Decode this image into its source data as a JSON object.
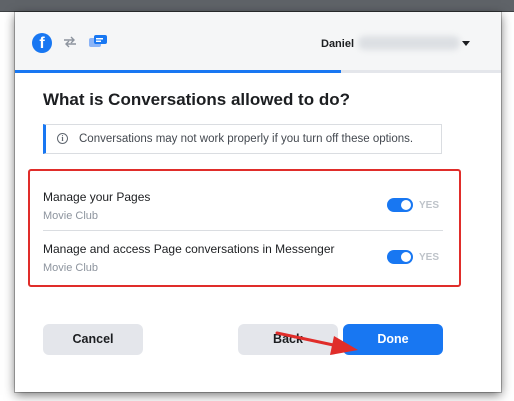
{
  "header": {
    "logo": "facebook-logo",
    "user_name": "Daniel"
  },
  "progress": {
    "fraction": 0.67
  },
  "dialog": {
    "title": "What is Conversations allowed to do?",
    "notice": "Conversations may not work properly if you turn off these options."
  },
  "permissions": [
    {
      "title": "Manage your Pages",
      "subtitle": "Movie Club",
      "toggle_label": "YES",
      "enabled": true
    },
    {
      "title": "Manage and access Page conversations in Messenger",
      "subtitle": "Movie Club",
      "toggle_label": "YES",
      "enabled": true
    }
  ],
  "buttons": {
    "cancel": "Cancel",
    "back": "Back",
    "done": "Done"
  },
  "colors": {
    "brand": "#1877f2",
    "annotation": "#e02d2a"
  }
}
